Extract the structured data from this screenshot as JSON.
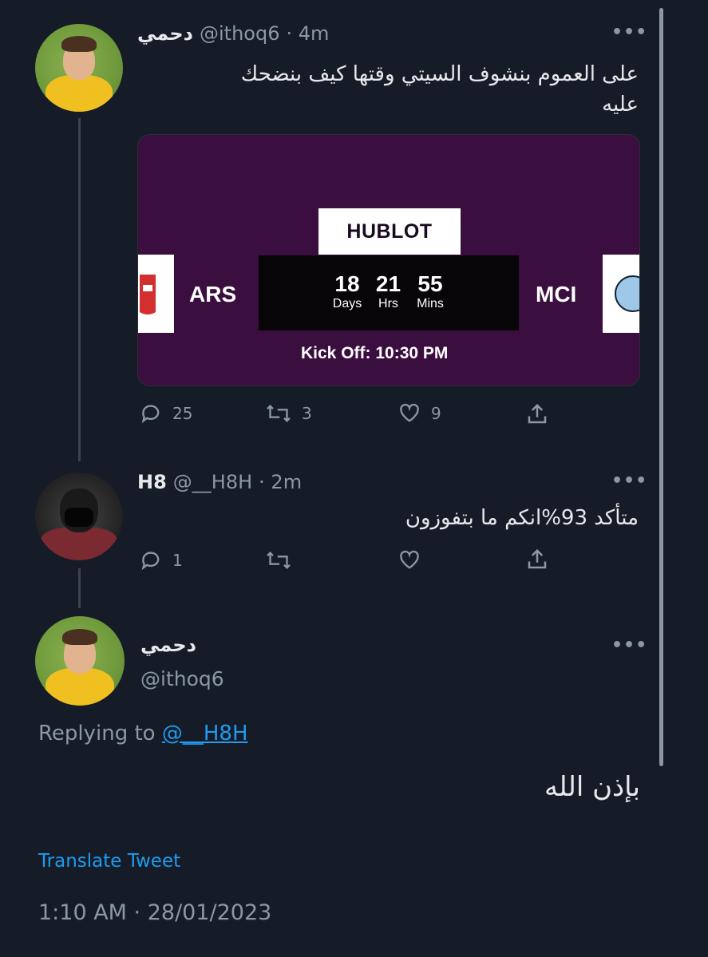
{
  "tweet1": {
    "display_name": "دحمي",
    "handle": "@ithoq6",
    "time": "· 4m",
    "text_line1": "على العموم بنشوف السيتي وقتها كيف بنضحك",
    "text_line2": "عليه",
    "card": {
      "sponsor": "HUBLOT",
      "home_team": "ARS",
      "away_team": "MCI",
      "days": "18",
      "days_label": "Days",
      "hours": "21",
      "hours_label": "Hrs",
      "mins": "55",
      "mins_label": "Mins",
      "kickoff": "Kick Off: 10:30 PM"
    },
    "replies": "25",
    "retweets": "3",
    "likes": "9"
  },
  "tweet2": {
    "display_name": "H8",
    "handle": "@__H8H",
    "time": "· 2m",
    "text": "متأكد 93%انكم ما بتفوزون",
    "replies": "1"
  },
  "tweet3": {
    "display_name": "دحمي",
    "handle": "@ithoq6",
    "replying_prefix": "Replying to",
    "replying_handle": "@__H8H",
    "text": "بإذن الله",
    "translate": "Translate Tweet",
    "timestamp": "1:10 AM · 28/01/2023"
  },
  "icons": {
    "more": "more-icon",
    "reply": "reply-icon",
    "retweet": "retweet-icon",
    "like": "heart-icon",
    "share": "share-icon"
  },
  "colors": {
    "background": "#151c28",
    "link": "#1d9bf0",
    "secondary": "#8b98a5",
    "card": "#3a0e3e"
  }
}
